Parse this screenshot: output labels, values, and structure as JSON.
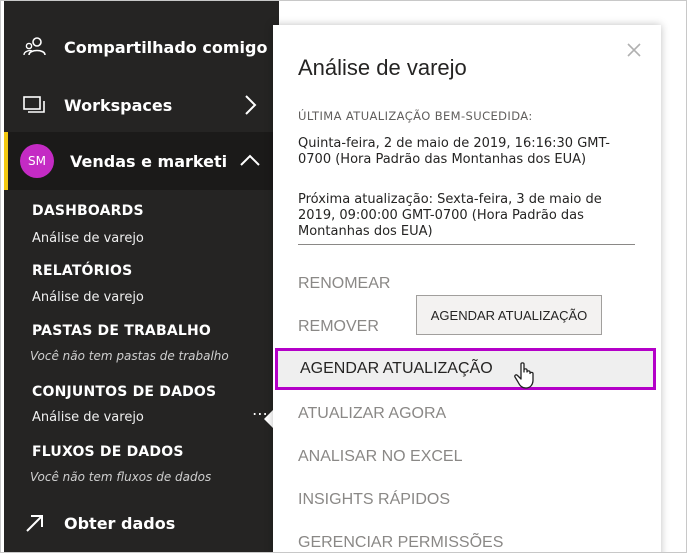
{
  "sidebar": {
    "shared_label": "Compartilhado comigo",
    "workspaces_label": "Workspaces",
    "workspace": {
      "avatar": "SM",
      "label": "Vendas e marketi"
    },
    "sections": {
      "dashboards": {
        "title": "DASHBOARDS",
        "item": "Análise de varejo"
      },
      "reports": {
        "title": "RELATÓRIOS",
        "item": "Análise de varejo"
      },
      "workbooks": {
        "title": "PASTAS DE TRABALHO",
        "empty": "Você não tem pastas de trabalho"
      },
      "datasets": {
        "title": "CONJUNTOS DE DADOS",
        "item": "Análise de varejo",
        "more": "⋯"
      },
      "dataflows": {
        "title": "FLUXOS DE DADOS",
        "empty": "Você não tem fluxos de dados"
      }
    },
    "get_data_label": "Obter dados"
  },
  "popup": {
    "title": "Análise de varejo",
    "last_refresh_caption": "ÚLTIMA ATUALIZAÇÃO BEM-SUCEDIDA:",
    "last_refresh_value": "Quinta-feira, 2 de maio de 2019, 16:16:30 GMT-0700 (Hora Padrão das Montanhas dos EUA)",
    "next_refresh": "Próxima atualização: Sexta-feira, 3 de maio de 2019, 09:00:00 GMT-0700 (Hora Padrão das Montanhas dos EUA)",
    "menu": {
      "rename": "RENOMEAR",
      "remove": "REMOVER",
      "schedule_refresh": "AGENDAR ATUALIZAÇÃO",
      "refresh_now": "ATUALIZAR AGORA",
      "analyze_excel": "ANALISAR NO EXCEL",
      "quick_insights": "INSIGHTS RÁPIDOS",
      "manage_permissions": "GERENCIAR PERMISSÕES"
    },
    "tooltip": "AGENDAR ATUALIZAÇÃO"
  },
  "colors": {
    "sidebar_bg": "#252423",
    "active_accent": "#f2c811",
    "avatar_bg": "#c42bc4",
    "highlight_border": "#b400c8"
  }
}
